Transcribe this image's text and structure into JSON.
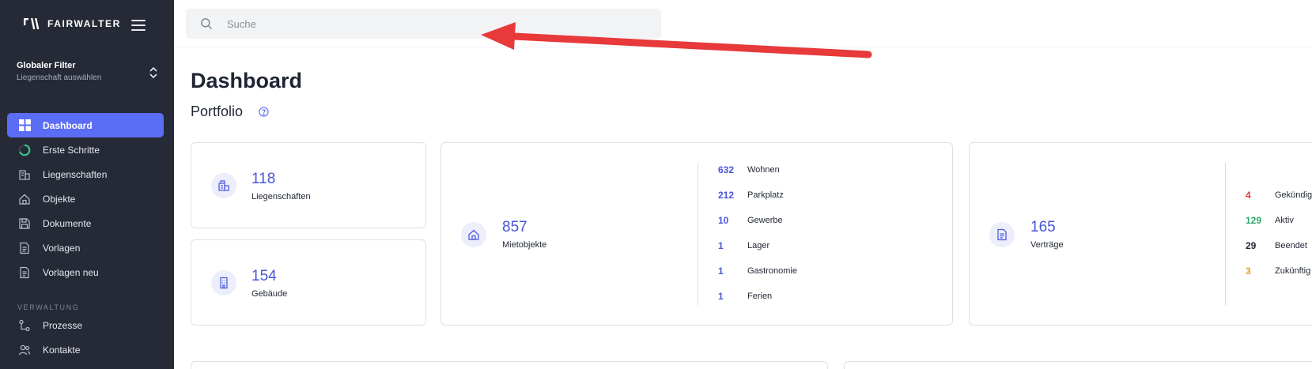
{
  "app": {
    "brand": "FAIRWALTER"
  },
  "filter": {
    "title": "Globaler Filter",
    "subtitle": "Liegenschaft auswählen"
  },
  "nav": {
    "items": [
      {
        "label": "Dashboard",
        "icon": "grid-icon",
        "active": true
      },
      {
        "label": "Erste Schritte",
        "icon": "progress-ring-icon"
      },
      {
        "label": "Liegenschaften",
        "icon": "buildings-icon"
      },
      {
        "label": "Objekte",
        "icon": "home-icon"
      },
      {
        "label": "Dokumente",
        "icon": "floppy-icon"
      },
      {
        "label": "Vorlagen",
        "icon": "document-icon"
      },
      {
        "label": "Vorlagen neu",
        "icon": "document-icon"
      }
    ],
    "section": "VERWALTUNG",
    "section_items": [
      {
        "label": "Prozesse",
        "icon": "process-icon"
      },
      {
        "label": "Kontakte",
        "icon": "contacts-icon"
      }
    ]
  },
  "search": {
    "placeholder": "Suche"
  },
  "page": {
    "title": "Dashboard",
    "section": "Portfolio"
  },
  "cards": {
    "liegenschaften": {
      "value": "118",
      "label": "Liegenschaften"
    },
    "gebaeude": {
      "value": "154",
      "label": "Gebäude"
    },
    "mietobjekte": {
      "value": "857",
      "label": "Mietobjekte",
      "breakdown": [
        {
          "n": "632",
          "label": "Wohnen"
        },
        {
          "n": "212",
          "label": "Parkplatz"
        },
        {
          "n": "10",
          "label": "Gewerbe"
        },
        {
          "n": "1",
          "label": "Lager"
        },
        {
          "n": "1",
          "label": "Gastronomie"
        },
        {
          "n": "1",
          "label": "Ferien"
        }
      ]
    },
    "vertraege": {
      "value": "165",
      "label": "Verträge",
      "breakdown": [
        {
          "n": "4",
          "label": "Gekündig",
          "color": "#e03a3a"
        },
        {
          "n": "129",
          "label": "Aktiv",
          "color": "#2aa86b"
        },
        {
          "n": "29",
          "label": "Beendet",
          "color": "#1f2533"
        },
        {
          "n": "3",
          "label": "Zukünftig",
          "color": "#e0a020"
        }
      ]
    }
  },
  "colors": {
    "accent": "#5b6cf5",
    "number": "#4756d8",
    "sidebar": "#252a36",
    "arrow": "#e8393b"
  }
}
